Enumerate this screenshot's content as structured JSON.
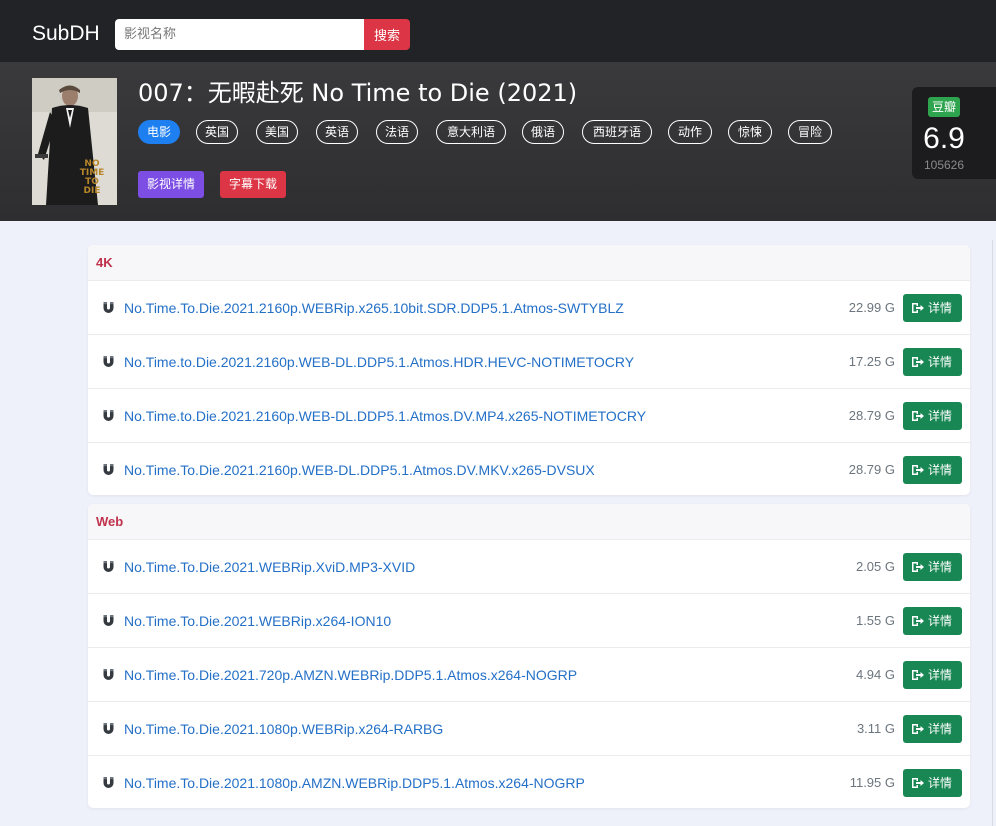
{
  "navbar": {
    "brand": "SubDH",
    "search_placeholder": "影视名称",
    "search_button": "搜索"
  },
  "movie": {
    "title": "007：无暇赴死 No Time to Die (2021)",
    "tags": [
      "电影",
      "英国",
      "美国",
      "英语",
      "法语",
      "意大利语",
      "俄语",
      "西班牙语",
      "动作",
      "惊悚",
      "冒险"
    ],
    "buttons": {
      "details": "影视详情",
      "subtitles": "字幕下载"
    },
    "poster_text": [
      "NO",
      "TIME",
      "TO",
      "DIE"
    ],
    "rating": {
      "source": "豆瓣",
      "score": "6.9",
      "votes": "105626"
    }
  },
  "sections": [
    {
      "title": "4K",
      "releases": [
        {
          "name": "No.Time.To.Die.2021.2160p.WEBRip.x265.10bit.SDR.DDP5.1.Atmos-SWTYBLZ",
          "size": "22.99 G"
        },
        {
          "name": "No.Time.to.Die.2021.2160p.WEB-DL.DDP5.1.Atmos.HDR.HEVC-NOTIMETOCRY",
          "size": "17.25 G"
        },
        {
          "name": "No.Time.to.Die.2021.2160p.WEB-DL.DDP5.1.Atmos.DV.MP4.x265-NOTIMETOCRY",
          "size": "28.79 G"
        },
        {
          "name": "No.Time.To.Die.2021.2160p.WEB-DL.DDP5.1.Atmos.DV.MKV.x265-DVSUX",
          "size": "28.79 G"
        }
      ]
    },
    {
      "title": "Web",
      "releases": [
        {
          "name": "No.Time.To.Die.2021.WEBRip.XviD.MP3-XVID",
          "size": "2.05 G"
        },
        {
          "name": "No.Time.To.Die.2021.WEBRip.x264-ION10",
          "size": "1.55 G"
        },
        {
          "name": "No.Time.To.Die.2021.720p.AMZN.WEBRip.DDP5.1.Atmos.x264-NOGRP",
          "size": "4.94 G"
        },
        {
          "name": "No.Time.To.Die.2021.1080p.WEBRip.x264-RARBG",
          "size": "3.11 G"
        },
        {
          "name": "No.Time.To.Die.2021.1080p.AMZN.WEBRip.DDP5.1.Atmos.x264-NOGRP",
          "size": "11.95 G"
        }
      ]
    }
  ],
  "row_button_label": "详情",
  "icons": {
    "release": "magnet-icon",
    "detail": "enter-arrow-icon"
  },
  "colors": {
    "navbar": "#222327",
    "danger": "#dc3545",
    "primary": "#1e7ff0",
    "purple": "#7c4ee4",
    "success": "#198754",
    "link": "#2470c7",
    "douban": "#2fa44f",
    "section_title": "#c0314c"
  }
}
